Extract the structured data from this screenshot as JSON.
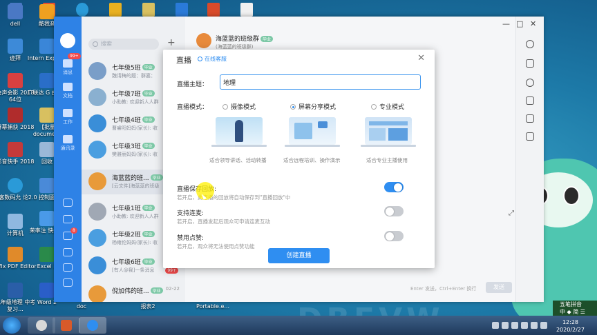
{
  "desktop": {
    "icons": [
      {
        "label": "dell",
        "color": "#4a78c4"
      },
      {
        "label": "迹拜",
        "color": "#3d8ad8"
      },
      {
        "label": "会声会影 2018 64位",
        "color": "#d84040"
      },
      {
        "label": "屏幕捕获 2018",
        "color": "#b02c2c"
      },
      {
        "label": "影音快手 2018",
        "color": "#c43a3a"
      },
      {
        "label": "极客数码允 论2.0",
        "color": "#2a9ad8"
      },
      {
        "label": "计算机",
        "color": "#8fb8e0"
      },
      {
        "label": "Infix PDF Editor",
        "color": "#e08a2a"
      },
      {
        "label": "九年级地理 中考复习...",
        "color": "#2a5ea8"
      }
    ],
    "icons2": [
      {
        "label": "酷我音",
        "color": "#f0a020"
      },
      {
        "label": "Intern Explore",
        "color": "#3a86d8"
      },
      {
        "label": "广联达 G 由GVi",
        "color": "#2a6ec8"
      },
      {
        "label": "【批量 document",
        "color": "#d8c060"
      },
      {
        "label": "回收",
        "color": "#9ab8d8"
      },
      {
        "label": "控制面",
        "color": "#4a8ad8"
      },
      {
        "label": "荣率注 快捷方",
        "color": "#4a9ae8"
      },
      {
        "label": "Excel 2",
        "color": "#2a8a4a"
      },
      {
        "label": "Word 2",
        "color": "#2a5ec8"
      }
    ],
    "bottom_labels": [
      "doc",
      "报表2",
      "Portable.e..."
    ],
    "bg_word": "DBEVW",
    "top_icon_colors": [
      "#e84e2e",
      "#2a9ad8",
      "#e8b020",
      "#d8c060",
      "#2a7ad8",
      "#d84a2a",
      "#f0f0f0"
    ]
  },
  "app": {
    "search_placeholder": "搜索",
    "plus": "+",
    "nav": {
      "messages": "消息",
      "docs": "文档",
      "work": "工作",
      "contacts": "通讯录",
      "badge": "99+",
      "badge2": "8"
    },
    "chats": [
      {
        "name": "七年级5班",
        "tag": "毕业",
        "msg": "魏请梅的题：群嘉：",
        "color": "#7a9ec8"
      },
      {
        "name": "七年级7班",
        "tag": "毕业",
        "msg": "小助教: 欢迎新人人群",
        "color": "#8ab0d0"
      },
      {
        "name": "七年级4班",
        "tag": "毕业",
        "msg": "曹睿阳妈妈(家长): 收",
        "color": "#3a8ed8"
      },
      {
        "name": "七年级3班",
        "tag": "毕业",
        "msg": "樊雅丽妈妈(家长): 收",
        "color": "#4a9ee0"
      },
      {
        "name": "海蓝蓝的班...",
        "tag": "毕业",
        "msg": "[云文件]海蓝蓝的班级",
        "color": "#e89a3a",
        "selected": true
      },
      {
        "name": "七年级1班",
        "tag": "毕业",
        "msg": "小助教: 欢迎新人人群",
        "color": "#a0a8b4"
      },
      {
        "name": "七年级2班",
        "tag": "毕业",
        "msg": "杨雍伦妈妈(家长): 收",
        "color": "#4a9ee0"
      },
      {
        "name": "七年级6班",
        "tag": "毕业",
        "msg": "[有人@我]一条消息",
        "color": "#3a8ed8",
        "count": "99+"
      },
      {
        "name": "倪加伟的班...",
        "tag": "毕业",
        "msg": "",
        "color": "#e89a3a",
        "time": "02-22"
      }
    ],
    "current_chat": {
      "title": "海蓝蓝的班级群",
      "tag": "毕业",
      "subtitle": "(海蓝蓝的班级群)"
    },
    "send_hint": "Enter 发送，Ctrl+Enter 换行",
    "send_button": "发送",
    "window_controls": [
      "—",
      "□",
      "✕"
    ]
  },
  "dialog": {
    "title": "直播",
    "service": "在线客服",
    "close": "✕",
    "topic_label": "直播主题：",
    "topic_value": "地理",
    "mode_label": "直播模式：",
    "modes": [
      {
        "label": "摄像模式",
        "caption": "适合领导讲话、活动转播",
        "selected": false
      },
      {
        "label": "屏幕分享模式",
        "caption": "适合远程培训、操作演示",
        "selected": true
      },
      {
        "label": "专业模式",
        "caption": "适合专业主播使用",
        "selected": false
      }
    ],
    "options": [
      {
        "label": "直播保存回放:",
        "desc": "若开启，此直播的回放将自动保存到\"直播回放\"中",
        "on": true
      },
      {
        "label": "支持连麦:",
        "desc": "若开启，直播发起后观众可申请连麦互动",
        "on": false
      },
      {
        "label": "禁用点赞:",
        "desc": "若开启，观众将无法使用点赞功能",
        "on": false
      }
    ],
    "create_button": "创建直播"
  },
  "taskbar": {
    "clock_time": "12:28",
    "clock_date": "2020/2/27",
    "ime_line1": "五笔拼音",
    "ime_line2": "中 ◆ 简 ☰"
  },
  "colors": {
    "accent": "#2f8ef1",
    "toggle_off": "#c9ccd1"
  }
}
